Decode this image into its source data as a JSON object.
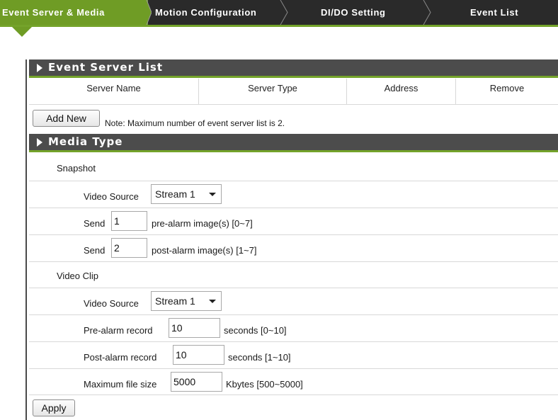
{
  "tabs": [
    {
      "label": "Event Server & Media",
      "active": true
    },
    {
      "label": "Motion Configuration",
      "active": false
    },
    {
      "label": "DI/DO Setting",
      "active": false
    },
    {
      "label": "Event List",
      "active": false
    }
  ],
  "event_server_list": {
    "title": "Event Server List",
    "columns": [
      "Server Name",
      "Server Type",
      "Address",
      "Remove"
    ],
    "add_new_label": "Add New",
    "note": "Note: Maximum number of event server list is 2."
  },
  "media_type": {
    "title": "Media Type",
    "snapshot": {
      "label": "Snapshot",
      "video_source_label": "Video Source",
      "video_source_value": "Stream 1",
      "send_label": "Send",
      "pre_alarm_value": "1",
      "pre_alarm_suffix": "pre-alarm image(s) [0~7]",
      "post_alarm_value": "2",
      "post_alarm_suffix": "post-alarm image(s) [1~7]"
    },
    "video_clip": {
      "label": "Video Clip",
      "video_source_label": "Video Source",
      "video_source_value": "Stream 1",
      "pre_alarm_label": "Pre-alarm record",
      "pre_alarm_value": "10",
      "pre_alarm_suffix": "seconds [0~10]",
      "post_alarm_label": "Post-alarm record",
      "post_alarm_value": "10",
      "post_alarm_suffix": "seconds [1~10]",
      "max_size_label": "Maximum file size",
      "max_size_value": "5000",
      "max_size_suffix": "Kbytes [500~5000]"
    }
  },
  "apply_label": "Apply",
  "colors": {
    "accent_green": "#6f9c25",
    "tab_bar": "#2a2a2a",
    "section_header": "#4c4c4c"
  }
}
